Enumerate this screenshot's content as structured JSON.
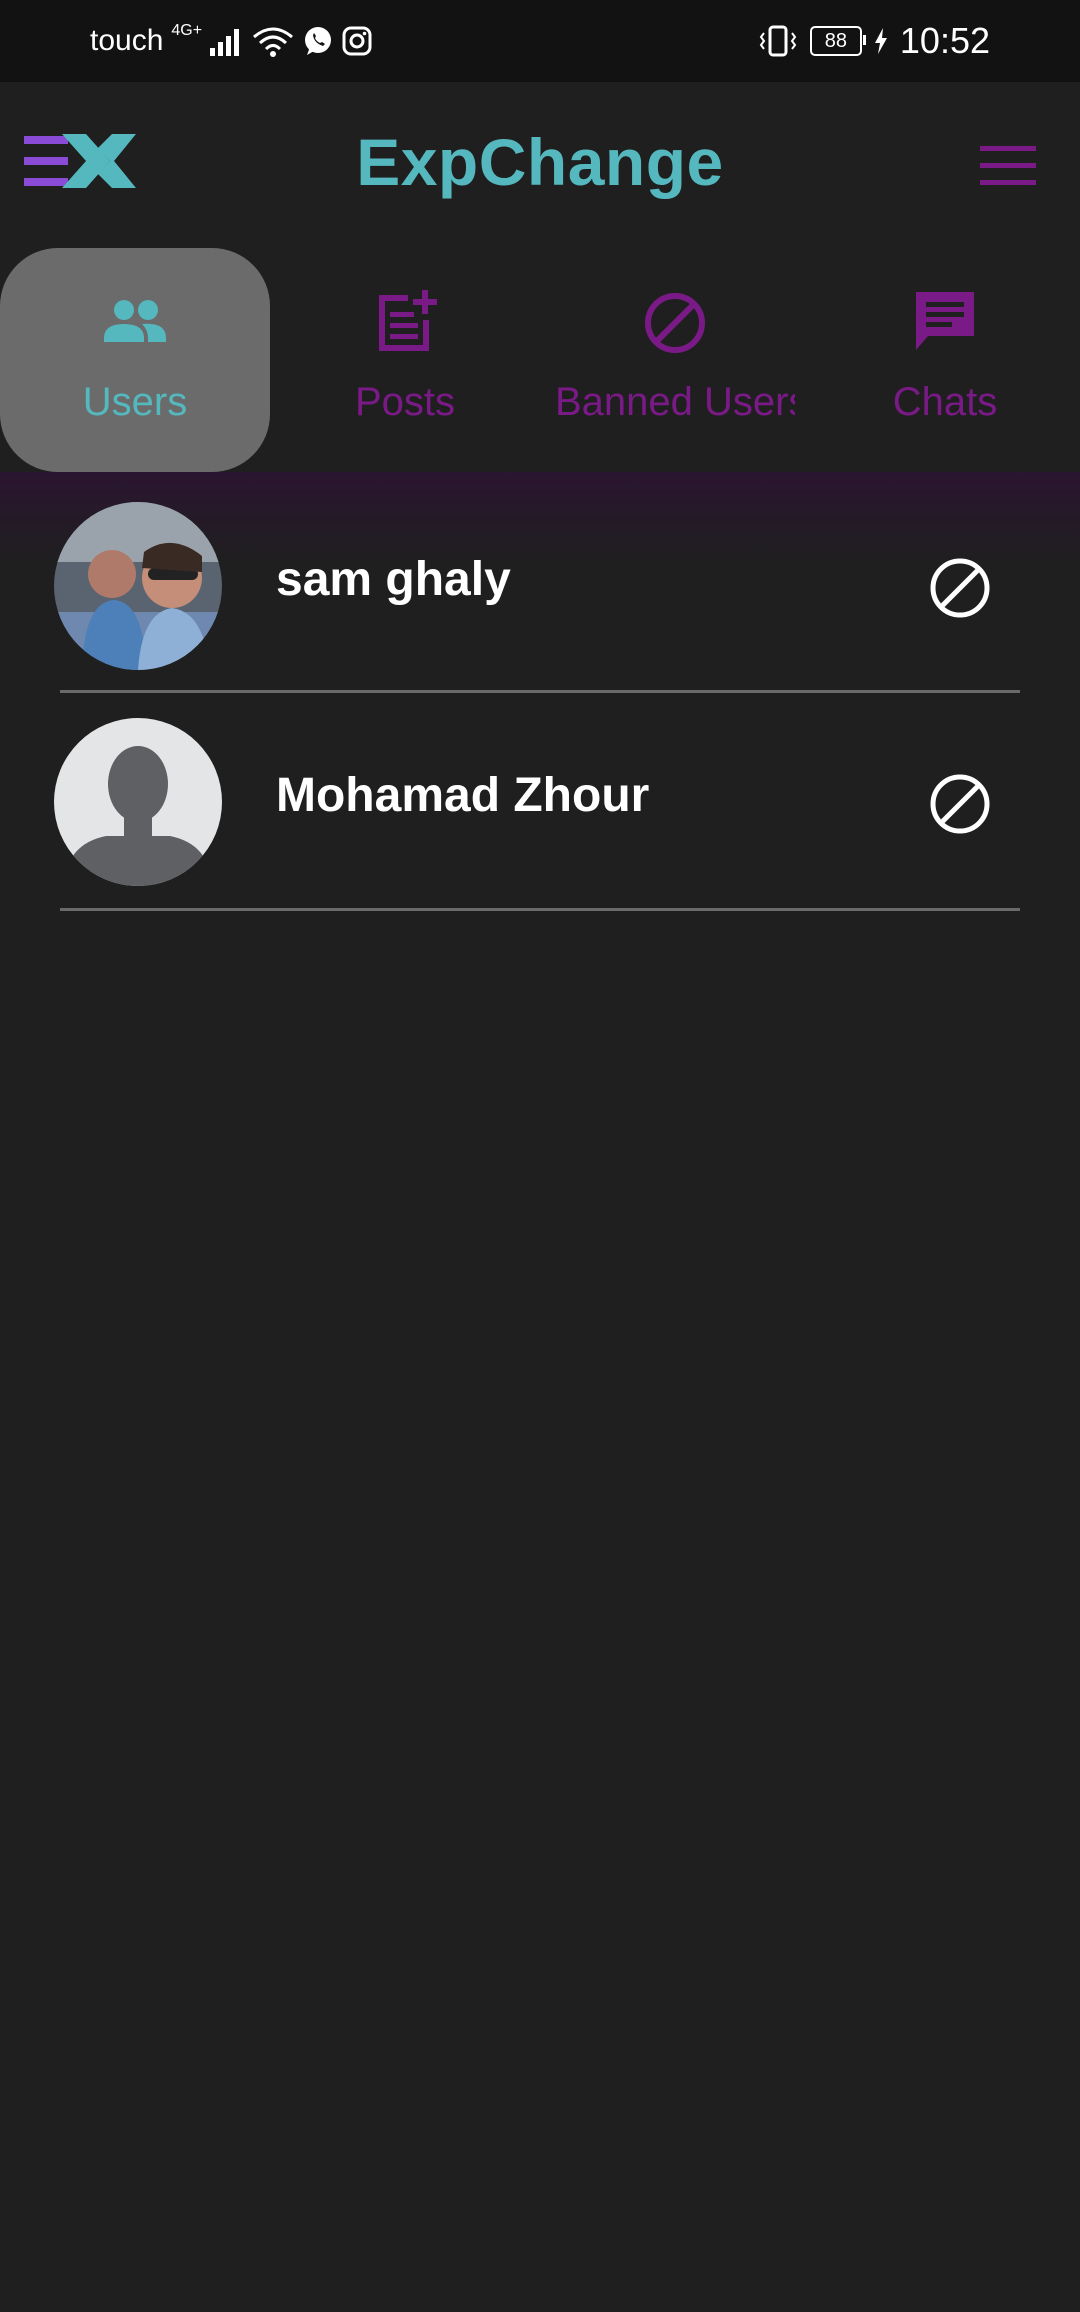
{
  "status_bar": {
    "carrier": "touch",
    "network": "4G+",
    "battery": "88",
    "time": "10:52"
  },
  "app": {
    "title": "ExpChange"
  },
  "tabs": [
    {
      "label": "Users",
      "icon": "users-icon",
      "active": true
    },
    {
      "label": "Posts",
      "icon": "post-add-icon",
      "active": false
    },
    {
      "label": "Banned Users",
      "icon": "banned-icon",
      "active": false
    },
    {
      "label": "Chats",
      "icon": "chat-icon",
      "active": false
    }
  ],
  "users": [
    {
      "name": "sam ghaly",
      "avatar": "photo-avatar"
    },
    {
      "name": "Mohamad Zhour",
      "avatar": "default-avatar"
    }
  ],
  "colors": {
    "accent_teal": "#54b8be",
    "accent_purple": "#7a1a86",
    "background": "#1f1f1f",
    "status_bar": "#121212",
    "active_tab": "#6b6b6b"
  }
}
